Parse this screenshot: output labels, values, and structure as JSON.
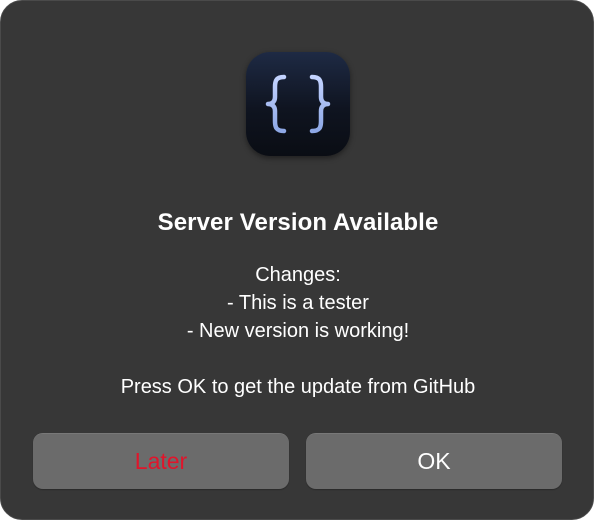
{
  "dialog": {
    "icon": "curly-braces-app-icon",
    "title": "Server Version Available",
    "message_lines": [
      "Changes:",
      "- This is a tester",
      "- New version is working!",
      "",
      "Press OK to get the update from GitHub"
    ],
    "buttons": {
      "later_label": "Later",
      "ok_label": "OK"
    }
  },
  "colors": {
    "dialog_background": "#373737",
    "button_background": "#6b6b6b",
    "destructive_text": "#e0152b",
    "icon_braces": "#a9bff0"
  }
}
